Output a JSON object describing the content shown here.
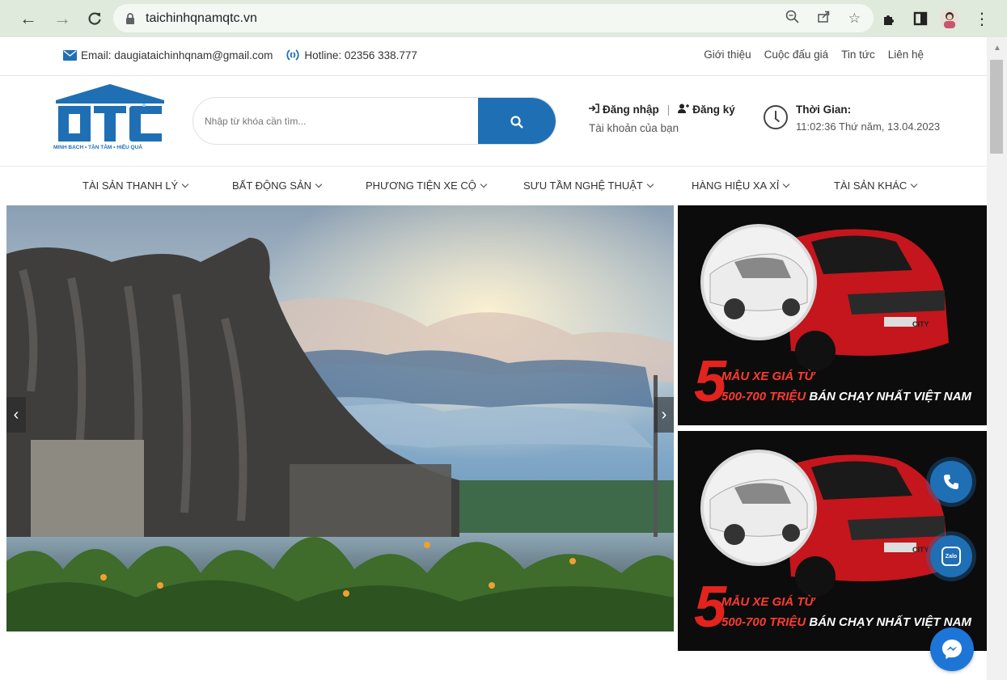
{
  "browser": {
    "url": "taichinhqnamqtc.vn"
  },
  "topbar": {
    "email_label": "Email: daugiataichinhqnam@gmail.com",
    "hotline_label": "Hotline: 02356 338.777",
    "links": [
      "Giới thiệu",
      "Cuộc đấu giá",
      "Tin tức",
      "Liên hệ"
    ]
  },
  "header": {
    "logo_text": "QTC",
    "logo_slogan": "MINH BẠCH • TẬN TÂM • HIỆU QUẢ",
    "search_placeholder": "Nhập từ khóa cần tìm...",
    "login_label": "Đăng nhập",
    "register_label": "Đăng ký",
    "account_label": "Tài khoản của bạn",
    "time_title": "Thời Gian:",
    "time_value": "11:02:36 Thứ năm, 13.04.2023"
  },
  "nav": {
    "items": [
      "TÀI SẢN THANH LÝ",
      "BẤT ĐỘNG SẢN",
      "PHƯƠNG TIỆN XE CỘ",
      "SƯU TẦM NGHỆ THUẬT",
      "HÀNG HIỆU XA XỈ",
      "TÀI SẢN KHÁC"
    ]
  },
  "banners": [
    {
      "number": "5",
      "line1": "MẪU XE GIÁ TỪ",
      "line2_price": "500-700 TRIỆU",
      "line2_rest": "BÁN CHẠY NHẤT VIỆT NAM",
      "car_badge": "CITY"
    },
    {
      "number": "5",
      "line1": "MẪU XE GIÁ TỪ",
      "line2_price": "500-700 TRIỆU",
      "line2_rest": "BÁN CHẠY NHẤT VIỆT NAM",
      "car_badge": "CITY"
    }
  ],
  "fab": {
    "zalo_label": "Zalo"
  },
  "colors": {
    "brand_blue": "#1f6fb5",
    "chrome_bg": "#dfe9dc",
    "banner_red": "#e3231e"
  }
}
